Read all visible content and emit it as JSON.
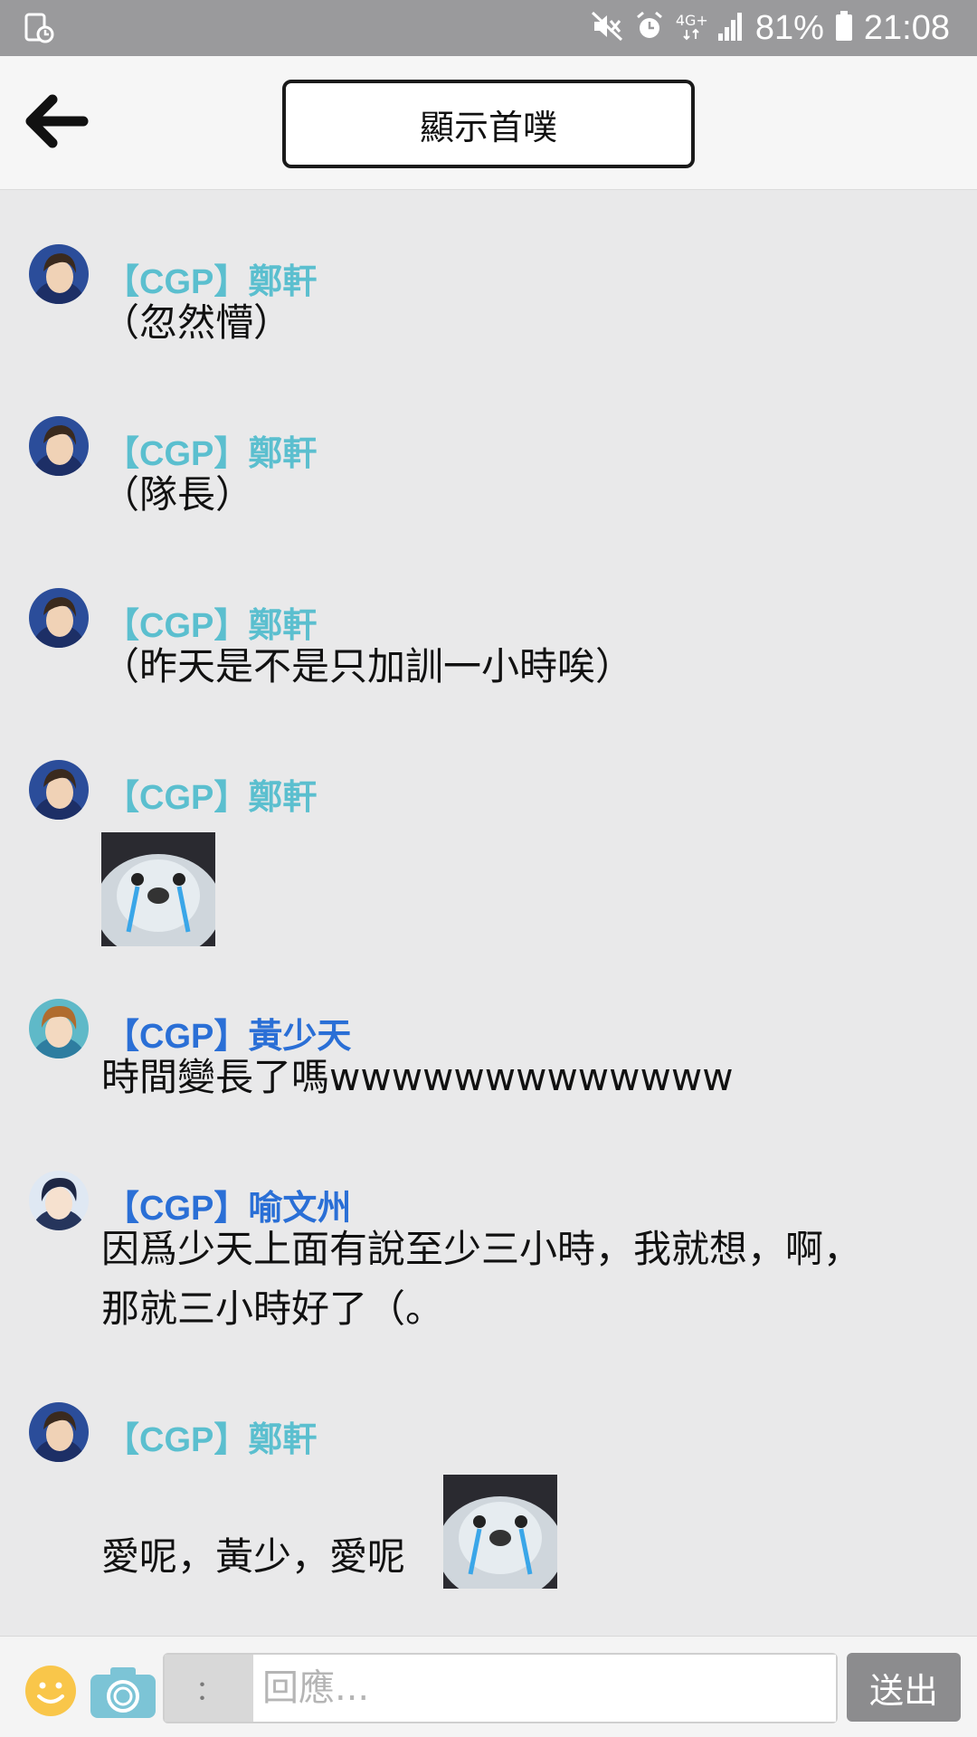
{
  "status_bar": {
    "battery": "81%",
    "time": "21:08",
    "network": "4G+"
  },
  "header": {
    "first_post_label": "顯示首噗"
  },
  "colors": {
    "name_teal": "#5bbfcf",
    "name_blue": "#2a6fd6"
  },
  "messages": [
    {
      "author": "【CGP】鄭軒",
      "text": "（忽然懵）"
    },
    {
      "author": "【CGP】鄭軒",
      "text": "（隊長）"
    },
    {
      "author": "【CGP】鄭軒",
      "text": "（昨天是不是只加訓一小時唉）"
    },
    {
      "author": "【CGP】鄭軒",
      "text": ""
    },
    {
      "author": "【CGP】黃少天",
      "text": "時間變長了嗎wwwwwwwwwwwww"
    },
    {
      "author": "【CGP】喻文州",
      "text_line1": "因爲少天上面有說至少三小時，我就想，啊，",
      "text_line2": "那就三小時好了（。"
    },
    {
      "author": "【CGP】鄭軒",
      "text": "愛呢，黃少，愛呢"
    }
  ],
  "input": {
    "prefix": "：",
    "placeholder": "回應...",
    "send_label": "送出"
  }
}
